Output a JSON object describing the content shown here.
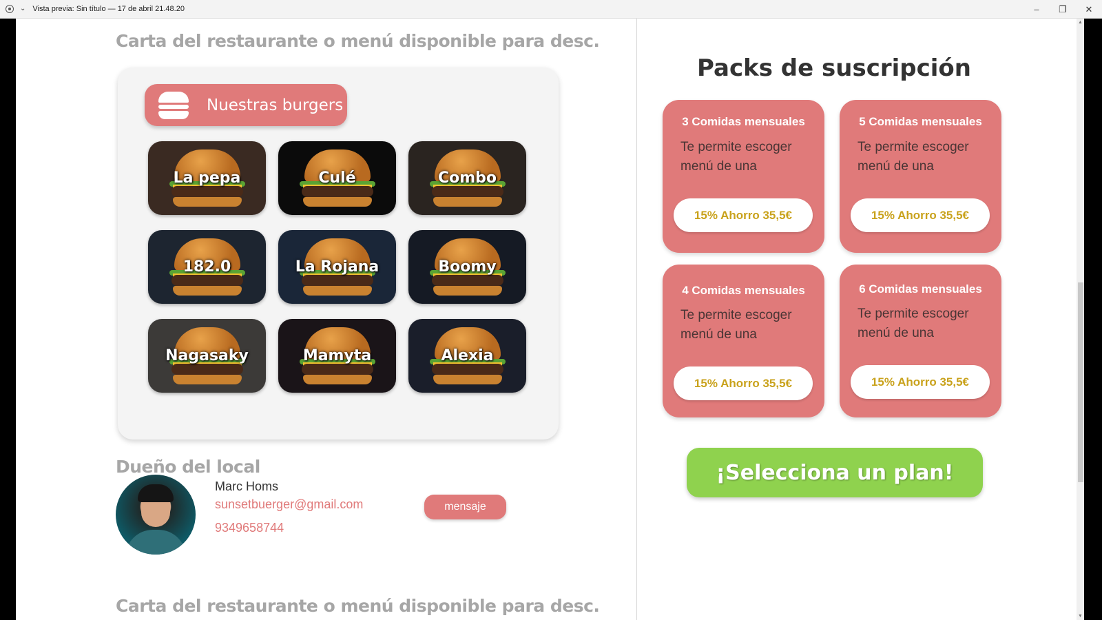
{
  "window": {
    "title": "Vista previa: Sin título — 17 de abril 21.48.20",
    "minimize": "–",
    "restore": "❐",
    "close": "✕"
  },
  "menu_section": {
    "title": "Carta del restaurante o menú disponible para desc.",
    "category_label": "Nuestras burgers",
    "burgers": [
      "La pepa",
      "Culé",
      "Combo",
      "182.0",
      "La Rojana",
      "Boomy",
      "Nagasaky",
      "Mamyta",
      "Alexia"
    ],
    "burger_backgrounds": [
      "#3a2a22",
      "#0b0b0b",
      "#2a2420",
      "#1d2530",
      "#1a2638",
      "#151a24",
      "#3c3a38",
      "#1a1418",
      "#1a1e2a"
    ]
  },
  "owner_section": {
    "title": "Dueño del local",
    "name": "Marc Homs",
    "email": "sunsetbuerger@gmail.com",
    "phone": "9349658744",
    "message_button": "mensaje"
  },
  "next_section_title_partial": "Carta del restaurante o menú disponible para desc.",
  "packs": {
    "title": "Packs de suscripción",
    "items": [
      {
        "title": "3 Comidas mensuales",
        "desc": "Te permite escoger menú de una",
        "price": "15% Ahorro 35,5€"
      },
      {
        "title": "5 Comidas mensuales",
        "desc": "Te permite escoger menú de una",
        "price": "15% Ahorro 35,5€"
      },
      {
        "title": "4 Comidas mensuales",
        "desc": "Te permite escoger menú de una",
        "price": "15% Ahorro 35,5€"
      },
      {
        "title": "6 Comidas mensuales",
        "desc": "Te permite escoger menú de una",
        "price": "15% Ahorro 35,5€"
      }
    ],
    "cta": "¡Selecciona un plan!"
  },
  "colors": {
    "accent": "#e07a7a",
    "cta_green": "#8fd24e",
    "price_gold": "#c9a21c",
    "section_gray": "#a6a6a6"
  }
}
